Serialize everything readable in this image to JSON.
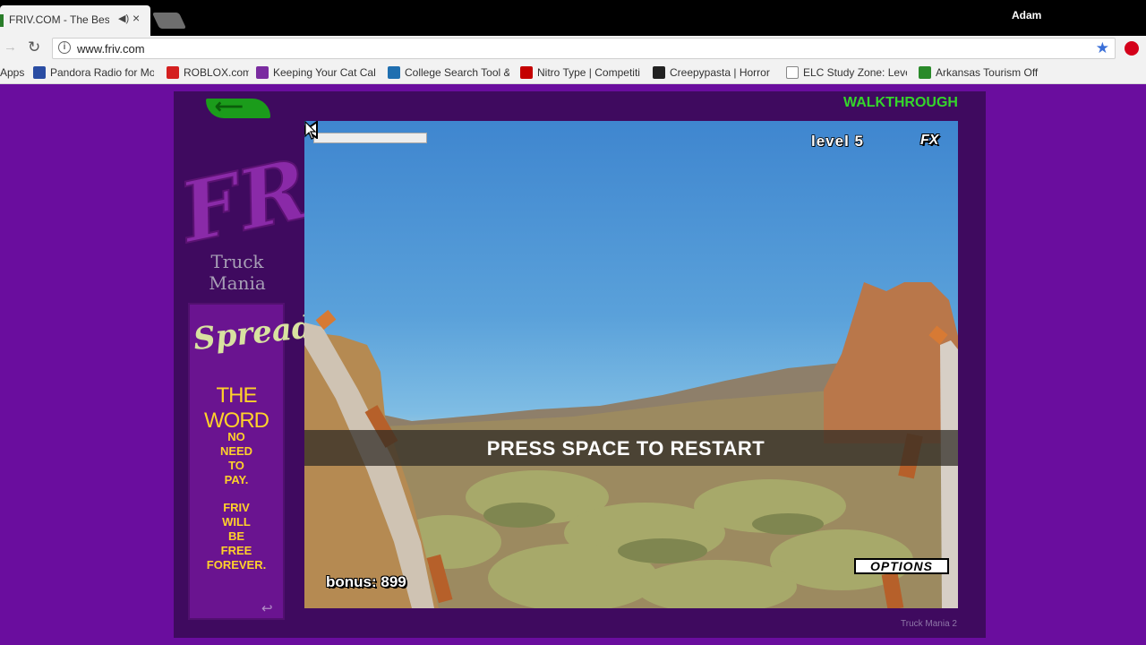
{
  "browser": {
    "tab_title": "FRIV.COM - The Best",
    "tab_audio_icon": "speaker-icon",
    "tab_close": "×",
    "user": "Adam",
    "url": "www.friv.com",
    "info_glyph": "i",
    "reload_glyph": "↻",
    "forward_glyph": "→",
    "star_glyph": "★",
    "bookmarks": [
      {
        "label": "Apps",
        "color": "#f2f2f2"
      },
      {
        "label": "Pandora Radio for Mo",
        "color": "#2a4da3"
      },
      {
        "label": "ROBLOX.com",
        "color": "#d42020"
      },
      {
        "label": "Keeping Your Cat Calm",
        "color": "#7a2ca0"
      },
      {
        "label": "College Search Tool &",
        "color": "#1f6fb0"
      },
      {
        "label": "Nitro Type | Competiti",
        "color": "#c40000"
      },
      {
        "label": "Creepypasta | Horror",
        "color": "#222222"
      },
      {
        "label": "ELC Study Zone: Level",
        "color": "#ffffff"
      },
      {
        "label": "Arkansas Tourism Offi",
        "color": "#2a8a2a"
      }
    ]
  },
  "site": {
    "back_glyph": "⟵",
    "logo_text": "FRIV",
    "game_name_line1": "Truck",
    "game_name_line2": "Mania",
    "spread_title": "Spread",
    "the_word": "THE WORD",
    "msg1": [
      "NO",
      "NEED",
      "TO",
      "PAY."
    ],
    "msg2": [
      "FRIV",
      "WILL",
      "BE",
      "FREE",
      "FOREVER."
    ],
    "return_glyph": "↩",
    "walkthrough": "WALKTHROUGH",
    "footer_title": "Truck Mania 2"
  },
  "game": {
    "level": "level 5",
    "fx": "FX",
    "restart": "PRESS SPACE TO RESTART",
    "bonus": "bonus: 899",
    "options": "OPTIONS",
    "progress_fraction": 1.0
  }
}
